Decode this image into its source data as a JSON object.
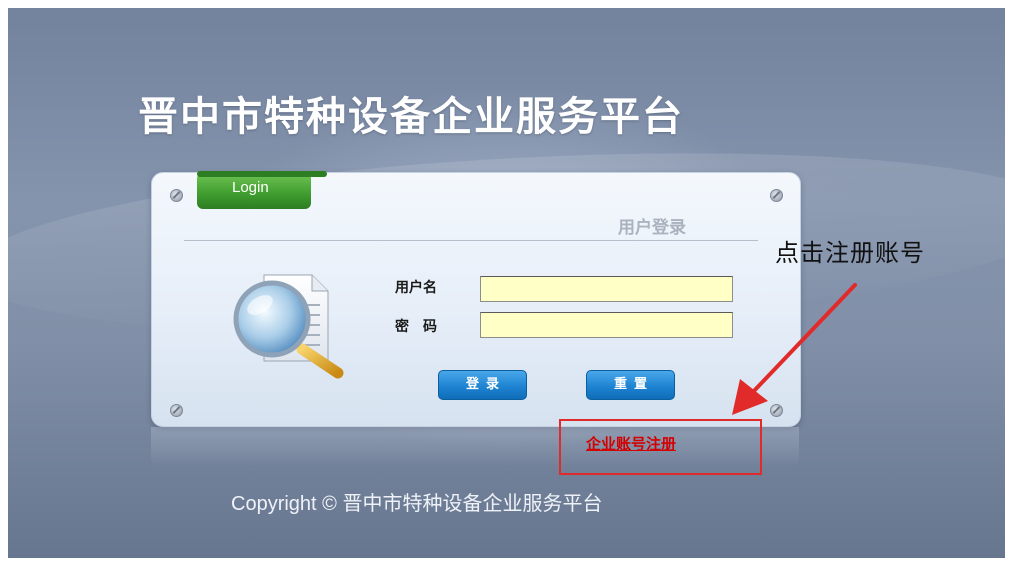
{
  "header": {
    "title": "晋中市特种设备企业服务平台"
  },
  "login_panel": {
    "tab_label": "Login",
    "subtitle": "用户登录",
    "username_label": "用户名",
    "password_label": "密　码",
    "username_value": "",
    "password_value": "",
    "login_button": "登录",
    "reset_button": "重置"
  },
  "register_link": "企业账号注册",
  "annotation": {
    "text": "点击注册账号",
    "color": "#e12a2a"
  },
  "footer": {
    "copyright": "Copyright © 晋中市特种设备企业服务平台"
  },
  "colors": {
    "accent_green": "#3e9a2e",
    "button_blue": "#1e84d2",
    "input_bg": "#ffffc6",
    "link_red": "#d40000"
  }
}
